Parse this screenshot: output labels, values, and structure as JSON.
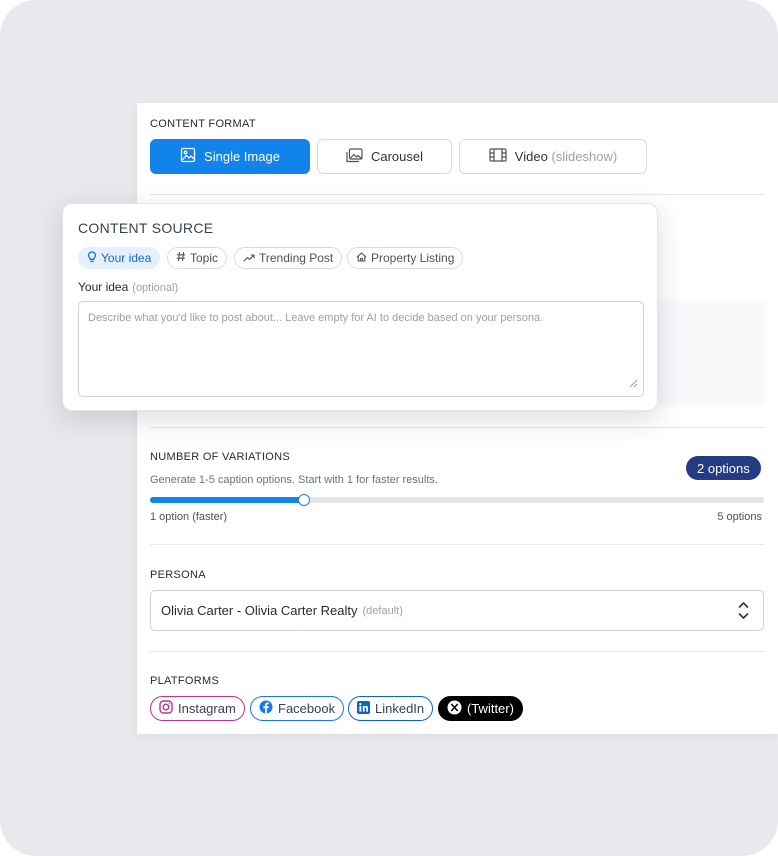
{
  "content_format": {
    "label": "CONTENT FORMAT",
    "options": [
      {
        "label": "Single Image",
        "suffix": "",
        "active": true,
        "icon": "image-icon"
      },
      {
        "label": "Carousel",
        "suffix": "",
        "active": false,
        "icon": "carousel-icon"
      },
      {
        "label": "Video",
        "suffix": "(slideshow)",
        "active": false,
        "icon": "film-icon"
      }
    ]
  },
  "content_source": {
    "label": "CONTENT SOURCE",
    "chips": [
      {
        "label": "Your idea",
        "active": true,
        "icon": "lightbulb-icon"
      },
      {
        "label": "Topic",
        "active": false,
        "icon": "hash-icon"
      },
      {
        "label": "Trending Post",
        "active": false,
        "icon": "trending-icon"
      },
      {
        "label": "Property Listing",
        "active": false,
        "icon": "home-icon"
      }
    ],
    "idea_label": "Your idea",
    "idea_optional": "(optional)",
    "idea_placeholder": "Describe what you'd like to post about... Leave empty for AI to decide based on your persona."
  },
  "variations": {
    "label": "NUMBER OF VARIATIONS",
    "badge": "2 options",
    "helper": "Generate 1-5 caption options. Start with 1 for faster results.",
    "value": 2,
    "min": 1,
    "max": 5,
    "min_label": "1 option (faster)",
    "max_label": "5 options"
  },
  "persona": {
    "label": "PERSONA",
    "selected": "Olivia Carter - Olivia Carter Realty",
    "selected_note": "(default)"
  },
  "platforms": {
    "label": "PLATFORMS",
    "items": [
      {
        "label": "Instagram",
        "icon": "instagram-icon",
        "color": "#c13584"
      },
      {
        "label": "Facebook",
        "icon": "facebook-icon",
        "color": "#1877f2"
      },
      {
        "label": "LinkedIn",
        "icon": "linkedin-icon",
        "color": "#0a66c2"
      },
      {
        "label": "(Twitter)",
        "icon": "x-icon",
        "color": "#000000"
      }
    ]
  },
  "colors": {
    "accent": "#1283ea",
    "badge": "#233c84"
  }
}
